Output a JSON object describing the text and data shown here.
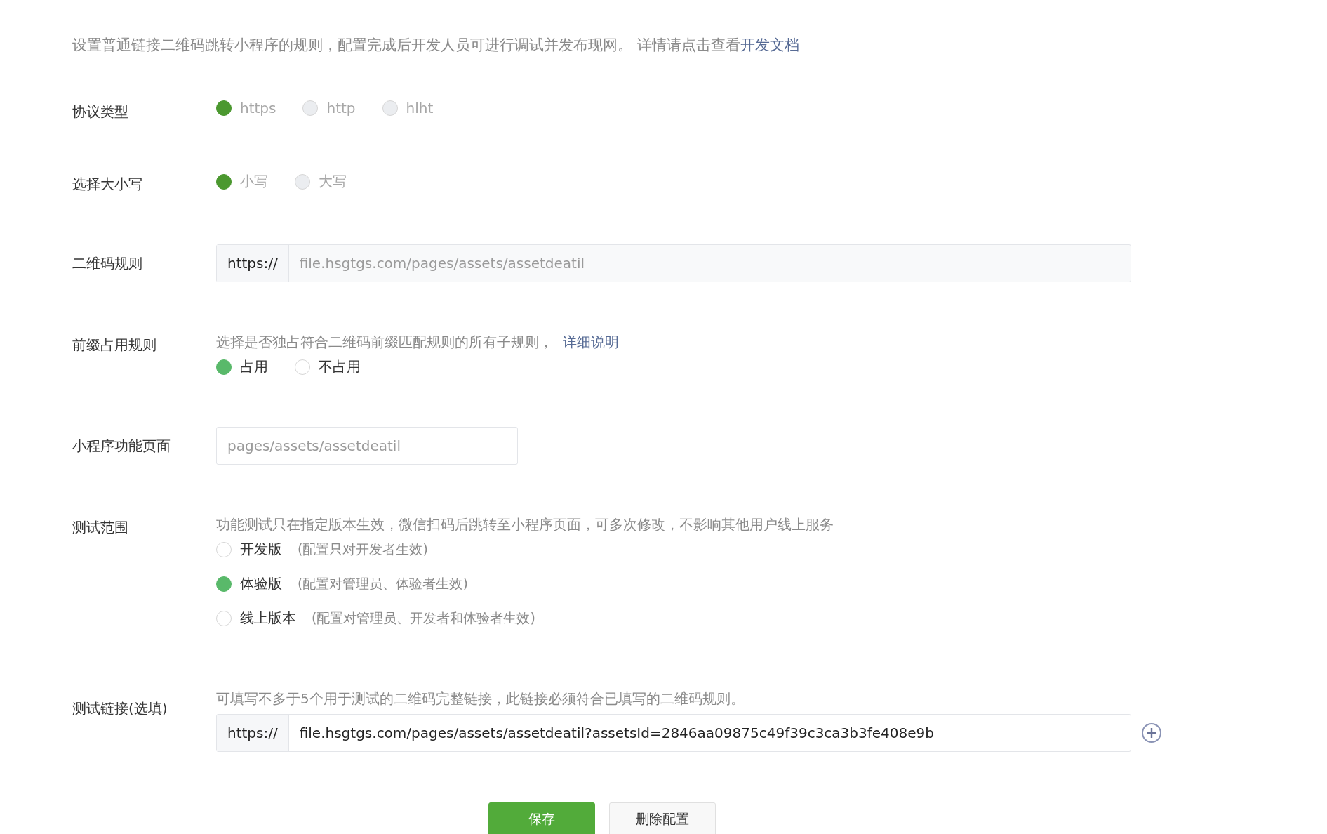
{
  "intro": {
    "text": "设置普通链接二维码跳转小程序的规则，配置完成后开发人员可进行调试并发布现网。 详情请点击查看",
    "link": "开发文档"
  },
  "rows": [
    {
      "kind": "radio",
      "label": "协议类型",
      "disabled": true,
      "options": [
        {
          "label": "https",
          "selected": true
        },
        {
          "label": "http",
          "selected": false
        },
        {
          "label": "hlht",
          "selected": false
        }
      ]
    },
    {
      "kind": "radio",
      "label": "选择大小写",
      "disabled": true,
      "options": [
        {
          "label": "小写",
          "selected": true
        },
        {
          "label": "大写",
          "selected": false
        }
      ]
    },
    {
      "kind": "prefixed",
      "label": "二维码规则",
      "prefix": "https://",
      "value": "file.hsgtgs.com/pages/assets/assetdeatil",
      "disabled": true
    },
    {
      "kind": "radio",
      "label": "前缀占用规则",
      "hint": "选择是否独占符合二维码前缀匹配规则的所有子规则，",
      "hint_link": "详细说明",
      "options": [
        {
          "label": "占用",
          "selected": true
        },
        {
          "label": "不占用",
          "selected": false
        }
      ]
    },
    {
      "kind": "field",
      "label": "小程序功能页面",
      "value": "pages/assets/assetdeatil",
      "disabled": true
    },
    {
      "kind": "stacked",
      "label": "测试范围",
      "hint": "功能测试只在指定版本生效，微信扫码后跳转至小程序页面，可多次修改，不影响其他用户线上服务",
      "options": [
        {
          "label": "开发版",
          "note": "(配置只对开发者生效)",
          "selected": false
        },
        {
          "label": "体验版",
          "note": "(配置对管理员、体验者生效)",
          "selected": true
        },
        {
          "label": "线上版本",
          "note": "(配置对管理员、开发者和体验者生效)",
          "selected": false
        }
      ]
    },
    {
      "kind": "prefixed",
      "label": "测试链接(选填)",
      "hint": "可填写不多于5个用于测试的二维码完整链接，此链接必须符合已填写的二维码规则。",
      "prefix": "https://",
      "value": "file.hsgtgs.com/pages/assets/assetdeatil?assetsId=2846aa09875c49f39c3ca3b3fe408e9b",
      "disabled": false,
      "addable": true
    }
  ],
  "buttons": [
    {
      "label": "保存",
      "kind": "primary"
    },
    {
      "label": "删除配置",
      "kind": "default"
    }
  ]
}
